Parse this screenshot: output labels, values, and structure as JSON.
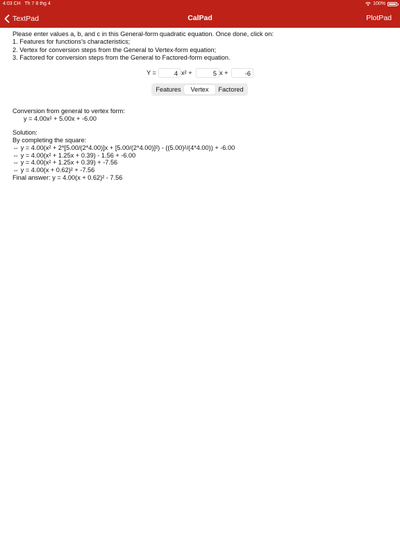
{
  "status": {
    "time": "4:03 CH",
    "date": "Th 7 8 thg 4",
    "battery": "100%"
  },
  "nav": {
    "back_label": "TextPad",
    "title": "CalPad",
    "right_label": "PlotPad"
  },
  "instructions": [
    "Please enter values a, b, and c in this General-form quadratic equation. Once done, click on:",
    "1. Features for functions's characteristics;",
    "2. Vertex for conversion steps from the General to Vertex-form equation;",
    "3. Factored for conversion steps from the General to Factored-form equation."
  ],
  "equation": {
    "y_label": "Y =",
    "a": "4",
    "x2_term": "x² +",
    "b": "5",
    "x_term": "x +",
    "c": "-6"
  },
  "tabs": {
    "features": "Features",
    "vertex": "Vertex",
    "factored": "Factored",
    "selected": "Vertex"
  },
  "result": {
    "heading": "Conversion from general to vertex form:",
    "equation": "y = 4.00x² + 5.00x + -6.00",
    "solution_label": "Solution:",
    "method": "By completing the square:",
    "steps": [
      "⇔ y = 4.00(x² + 2*[5.00/(2*4.00)]x + [5.00/(2*4.00)]²) - ((5.00)²/(4*4.00)) + -6.00",
      "⇔ y = 4.00(x² + 1.25x + 0.39) - 1.56 + -6.00",
      "⇔ y = 4.00(x² + 1.25x + 0.39) + -7.56",
      "⇔ y = 4.00(x + 0.62)² + -7.56"
    ],
    "final": "Final answer: y = 4.00(x + 0.62)² - 7.56"
  },
  "colors": {
    "accent": "#be2117"
  },
  "icons": {
    "back": "chevron-left-icon",
    "wifi": "wifi-icon",
    "battery": "battery-icon"
  }
}
